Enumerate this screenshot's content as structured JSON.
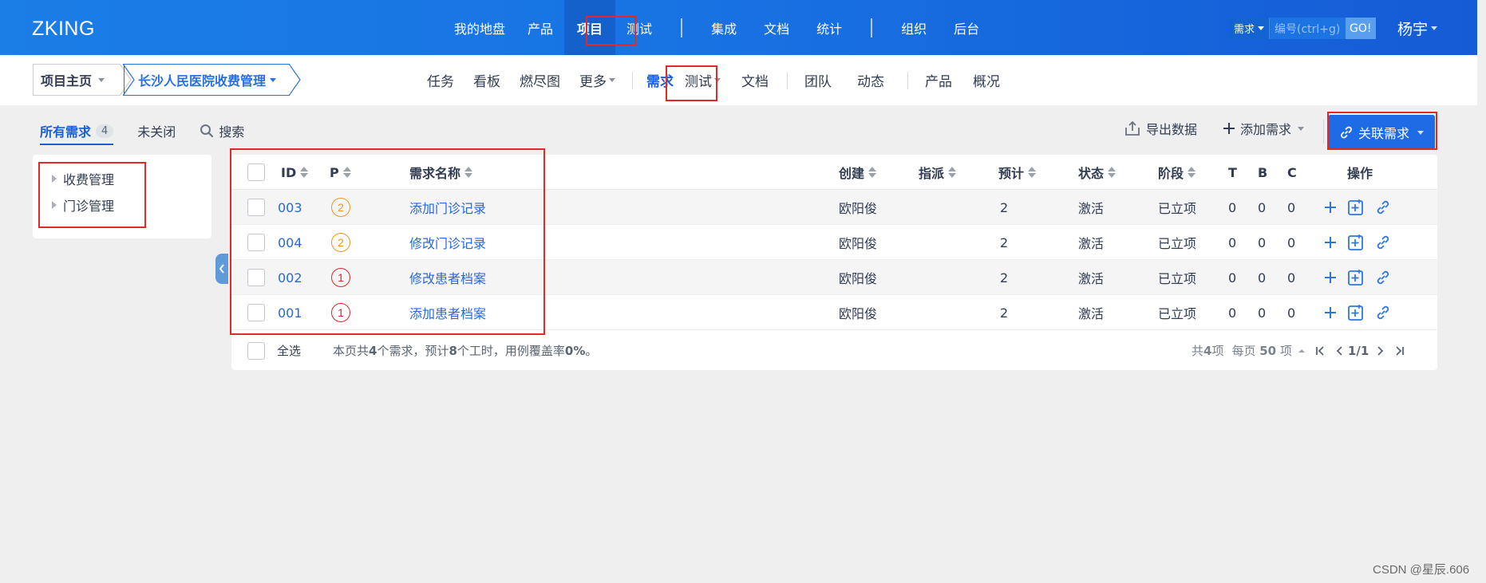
{
  "header": {
    "brand": "ZKING",
    "nav": [
      {
        "label": "我的地盘",
        "active": false
      },
      {
        "label": "产品",
        "active": false
      },
      {
        "label": "项目",
        "active": true
      },
      {
        "label": "测试",
        "active": false
      },
      {
        "label": "集成",
        "active": false
      },
      {
        "label": "文档",
        "active": false
      },
      {
        "label": "统计",
        "active": false
      },
      {
        "label": "组织",
        "active": false
      },
      {
        "label": "后台",
        "active": false
      }
    ],
    "search": {
      "type": "需求",
      "placeholder": "编号(ctrl+g)",
      "go": "GO!"
    },
    "user": "杨宇"
  },
  "subheader": {
    "breadcrumb": {
      "home": "项目主页",
      "project": "长沙人民医院收费管理"
    },
    "nav": [
      {
        "label": "任务",
        "active": false,
        "dropdown": false
      },
      {
        "label": "看板",
        "active": false,
        "dropdown": false
      },
      {
        "label": "燃尽图",
        "active": false,
        "dropdown": false
      },
      {
        "label": "更多",
        "active": false,
        "dropdown": true
      },
      {
        "label": "需求",
        "active": true,
        "dropdown": false
      },
      {
        "label": "测试",
        "active": false,
        "dropdown": true
      },
      {
        "label": "文档",
        "active": false,
        "dropdown": false
      },
      {
        "label": "团队",
        "active": false,
        "dropdown": false
      },
      {
        "label": "动态",
        "active": false,
        "dropdown": false
      },
      {
        "label": "产品",
        "active": false,
        "dropdown": false
      },
      {
        "label": "概况",
        "active": false,
        "dropdown": false
      }
    ]
  },
  "toolbar": {
    "tab_all": "所有需求",
    "tab_all_count": "4",
    "tab_open": "未关闭",
    "search": "搜索",
    "export": "导出数据",
    "add": "添加需求",
    "link": "关联需求"
  },
  "tree": [
    "收费管理",
    "门诊管理"
  ],
  "table": {
    "columns": {
      "id": "ID",
      "p": "P",
      "name": "需求名称",
      "creator": "创建",
      "assign": "指派",
      "estimate": "预计",
      "status": "状态",
      "stage": "阶段",
      "t": "T",
      "b": "B",
      "c": "C",
      "actions": "操作"
    },
    "rows": [
      {
        "id": "003",
        "p": "2",
        "name": "添加门诊记录",
        "creator": "欧阳俊",
        "assign": "",
        "estimate": "2",
        "status": "激活",
        "stage": "已立项",
        "t": "0",
        "b": "0",
        "c": "0"
      },
      {
        "id": "004",
        "p": "2",
        "name": "修改门诊记录",
        "creator": "欧阳俊",
        "assign": "",
        "estimate": "2",
        "status": "激活",
        "stage": "已立项",
        "t": "0",
        "b": "0",
        "c": "0"
      },
      {
        "id": "002",
        "p": "1",
        "name": "修改患者档案",
        "creator": "欧阳俊",
        "assign": "",
        "estimate": "2",
        "status": "激活",
        "stage": "已立项",
        "t": "0",
        "b": "0",
        "c": "0"
      },
      {
        "id": "001",
        "p": "1",
        "name": "添加患者档案",
        "creator": "欧阳俊",
        "assign": "",
        "estimate": "2",
        "status": "激活",
        "stage": "已立项",
        "t": "0",
        "b": "0",
        "c": "0"
      }
    ],
    "footer": {
      "select_all": "全选",
      "summary_prefix": "本页共 ",
      "summary_count": "4",
      "summary_mid": " 个需求，预计 ",
      "summary_hours": "8",
      "summary_mid2": " 个工时，用例覆盖率 ",
      "summary_rate": "0%",
      "summary_end": "。",
      "total_prefix": "共 ",
      "total": "4",
      "total_suffix": " 项",
      "per_page_prefix": "每页 ",
      "per_page": "50",
      "per_page_suffix": " 项",
      "page": "1/1"
    }
  },
  "colors": {
    "p2": "#f0941c",
    "p1": "#d8262a",
    "accent": "#1f6be6",
    "highlight": "#e02a2a"
  },
  "watermark": "CSDN @星辰.606"
}
